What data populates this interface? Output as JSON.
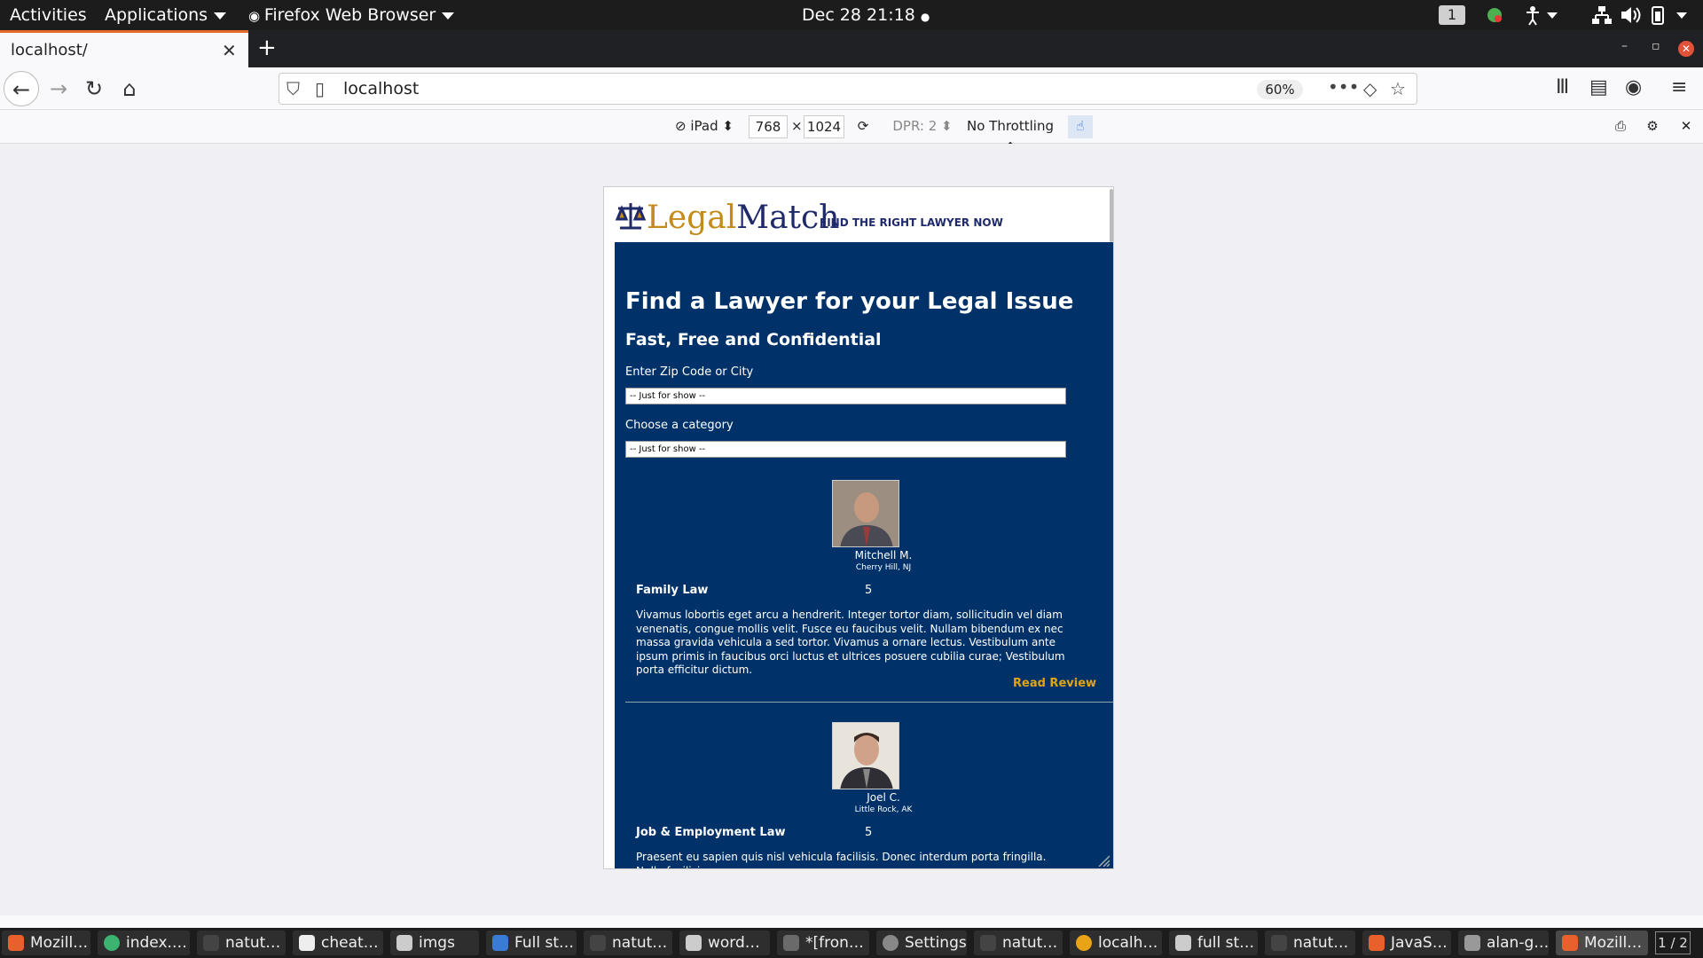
{
  "topbar": {
    "activities": "Activities",
    "applications": "Applications",
    "app_name": "Firefox Web Browser",
    "clock": "Dec 28  21:18",
    "workspace": "1"
  },
  "browser": {
    "tab_title": "localhost/",
    "url": "localhost",
    "zoom": "60%"
  },
  "rdm": {
    "device": "iPad",
    "width": "768",
    "times": "×",
    "height": "1024",
    "dpr": "DPR: 2",
    "throttling": "No Throttling"
  },
  "page": {
    "logo_legal": "Legal",
    "logo_match": "Match",
    "tagline": "FIND THE RIGHT LAWYER NOW",
    "heading": "Find a Lawyer for your Legal Issue",
    "subheading": "Fast, Free and Confidential",
    "zip_label": "Enter Zip Code or City",
    "zip_select": "-- Just for show --",
    "category_label": "Choose a category",
    "category_select": "-- Just for show --",
    "reviews": [
      {
        "name": "Mitchell M.",
        "location": "Cherry Hill, NJ",
        "category": "Family Law",
        "rating": "5",
        "text": "Vivamus lobortis eget arcu a hendrerit. Integer tortor diam, sollicitudin vel diam venenatis, congue mollis velit. Fusce eu faucibus velit. Nullam bibendum ex nec massa gravida vehicula a sed tortor. Vivamus a ornare lectus. Vestibulum ante ipsum primis in faucibus orci luctus et ultrices posuere cubilia curae; Vestibulum porta efficitur dictum.",
        "link": "Read Review"
      },
      {
        "name": "Joel C.",
        "location": "Little Rock, AK",
        "category": "Job & Employment Law",
        "rating": "5",
        "text": "Praesent eu sapien quis nisl vehicula facilisis. Donec interdum porta fringilla. Nulla facilisi."
      }
    ]
  },
  "taskbar": {
    "items": [
      "Mozill…",
      "index.…",
      "natut…",
      "cheat…",
      "imgs",
      "Full st…",
      "natut…",
      "word…",
      "*[fron…",
      "Settings",
      "natut…",
      "localh…",
      "full st…",
      "natut…",
      "JavaS…",
      "alan-g…",
      "Mozill…"
    ],
    "pager": "1 / 2"
  }
}
